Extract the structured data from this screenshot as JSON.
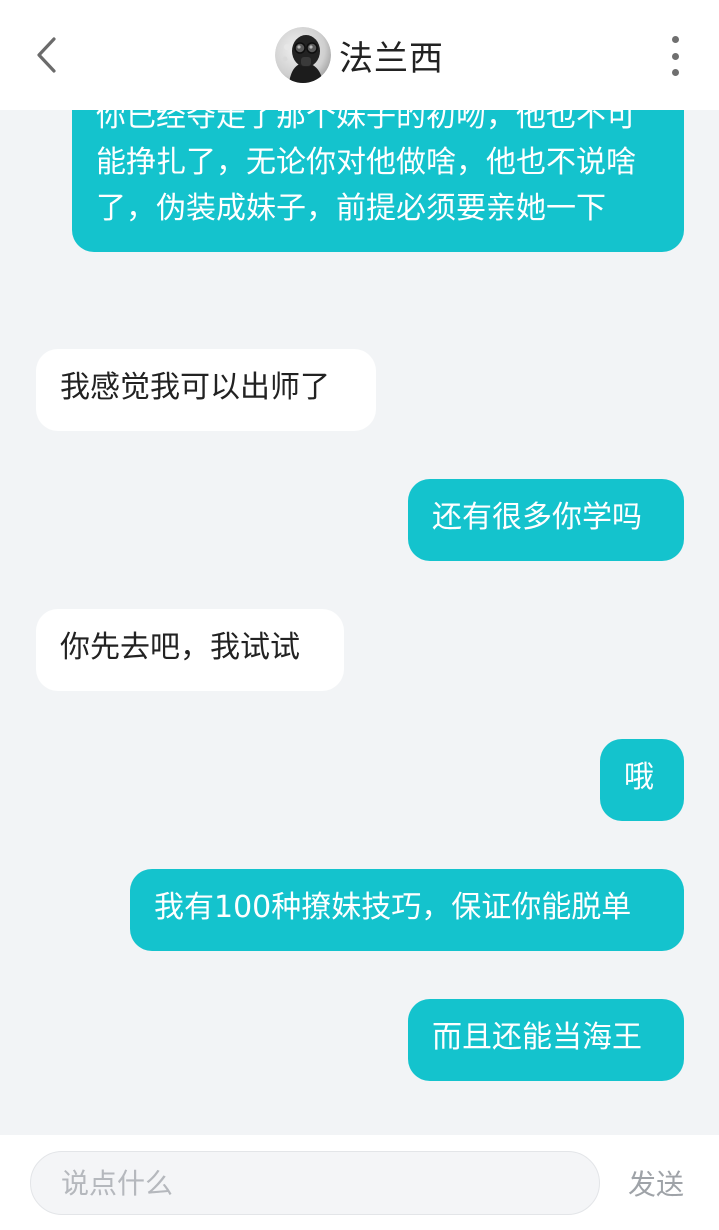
{
  "header": {
    "title": "法兰西",
    "back_icon": "chevron-left-icon",
    "more_icon": "more-vertical-icon"
  },
  "messages": [
    {
      "side": "out",
      "text": "你已经夺走了那个妹子的初吻，他也不可能挣扎了，无论你对他做啥，他也不说啥了，伪装成妹子，前提必须要亲她一下"
    },
    {
      "side": "in",
      "text": "我感觉我可以出师了"
    },
    {
      "side": "out",
      "text": "还有很多你学吗"
    },
    {
      "side": "in",
      "text": "你先去吧，我试试"
    },
    {
      "side": "out",
      "text": "哦"
    },
    {
      "side": "out",
      "text": "我有100种撩妹技巧，保证你能脱单"
    },
    {
      "side": "out",
      "text": "而且还能当海王"
    }
  ],
  "composer": {
    "placeholder": "说点什么",
    "send_label": "发送"
  },
  "colors": {
    "outgoing_bubble": "#14c3cd",
    "incoming_bubble": "#ffffff",
    "background": "#f2f4f6"
  }
}
